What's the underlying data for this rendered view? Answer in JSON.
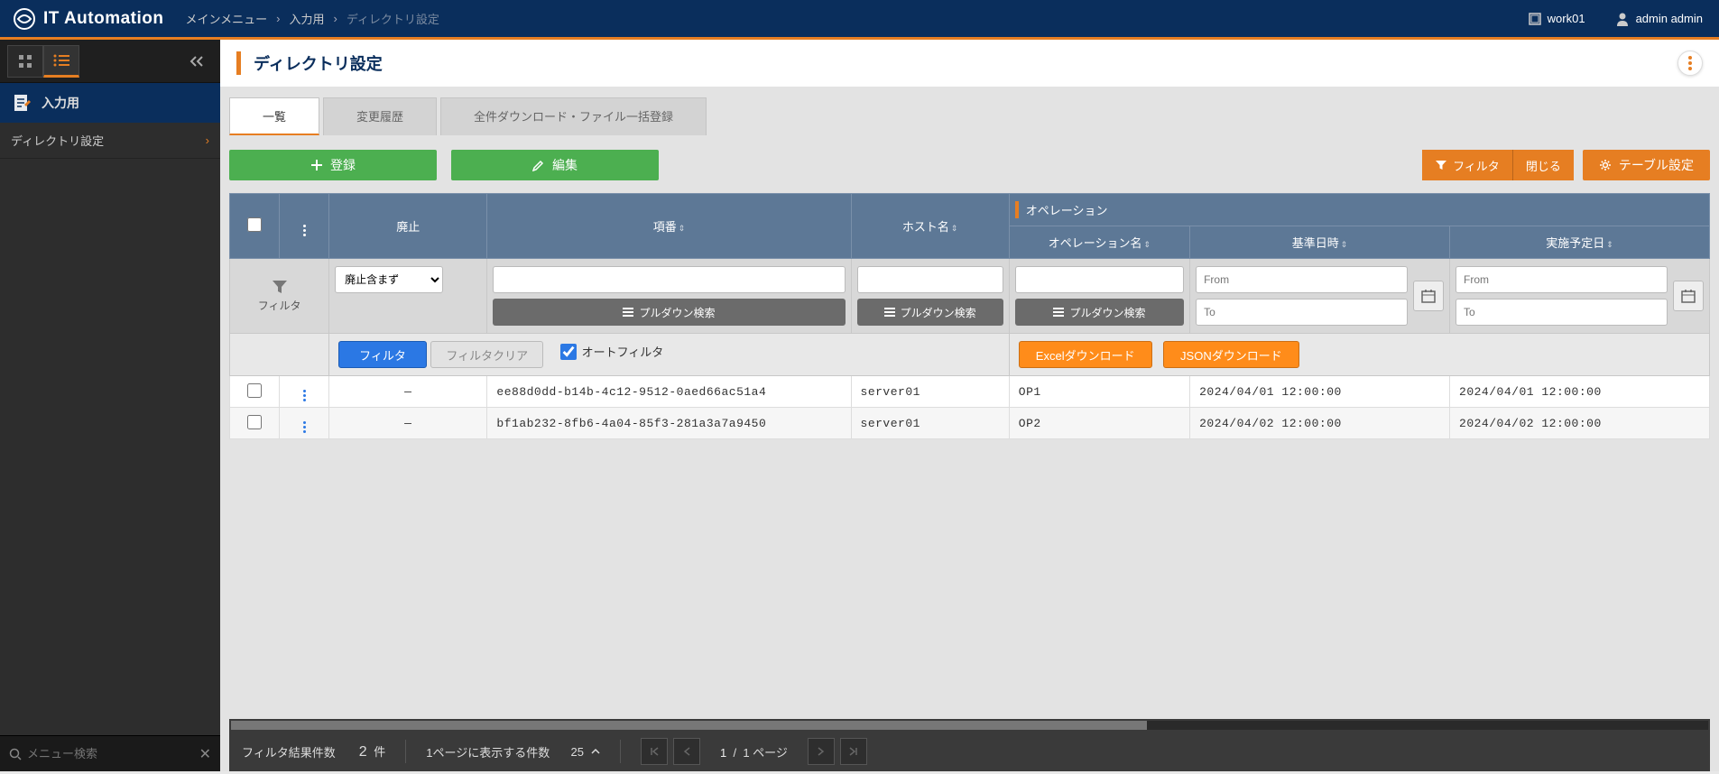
{
  "app_title": "IT Automation",
  "breadcrumbs": {
    "items": [
      "メインメニュー",
      "入力用",
      "ディレクトリ設定"
    ]
  },
  "workspace": "work01",
  "user": "admin admin",
  "sidebar": {
    "section_label": "入力用",
    "items": [
      "ディレクトリ設定"
    ],
    "search_placeholder": "メニュー検索"
  },
  "page": {
    "title": "ディレクトリ設定",
    "tabs": [
      "一覧",
      "変更履歴",
      "全件ダウンロード・ファイル一括登録"
    ]
  },
  "buttons": {
    "register": "登録",
    "edit": "編集",
    "filter": "フィルタ",
    "close": "閉じる",
    "table_settings": "テーブル設定",
    "pulldown_search": "プルダウン検索",
    "filter_apply": "フィルタ",
    "filter_clear": "フィルタクリア",
    "auto_filter": "オートフィルタ",
    "excel_download": "Excelダウンロード",
    "json_download": "JSONダウンロード"
  },
  "columns": {
    "discard": "廃止",
    "item_no": "項番",
    "host": "ホスト名",
    "operation_group": "オペレーション",
    "operation_name": "オペレーション名",
    "base_date": "基準日時",
    "planned_date": "実施予定日"
  },
  "filters": {
    "label": "フィルタ",
    "discard_select": "廃止含まず",
    "from": "From",
    "to": "To"
  },
  "rows": [
    {
      "item_no": "ee88d0dd-b14b-4c12-9512-0aed66ac51a4",
      "host": "server01",
      "operation_name": "OP1",
      "base_date": "2024/04/01 12:00:00",
      "planned_date": "2024/04/01 12:00:00"
    },
    {
      "item_no": "bf1ab232-8fb6-4a04-85f3-281a3a7a9450",
      "host": "server01",
      "operation_name": "OP2",
      "base_date": "2024/04/02 12:00:00",
      "planned_date": "2024/04/02 12:00:00"
    }
  ],
  "footer": {
    "result_label": "フィルタ結果件数",
    "count": "2",
    "count_unit": "件",
    "perpage_label": "1ページに表示する件数",
    "perpage_value": "25",
    "page_current": "1",
    "page_sep": "/",
    "page_total": "1",
    "page_unit": "ページ"
  }
}
